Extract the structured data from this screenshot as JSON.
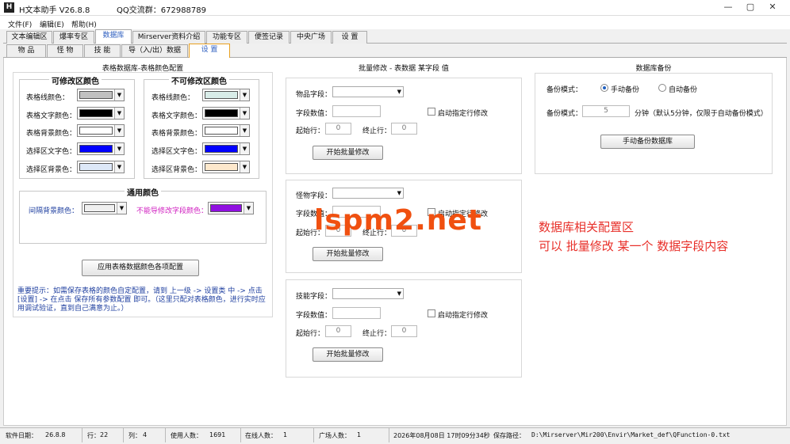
{
  "window": {
    "title": "H文本助手  V26.8.8",
    "qq": "QQ交流群：672988789",
    "controls": [
      "—",
      "▢",
      "✕"
    ]
  },
  "menu": [
    "文件(F)",
    "编辑(E)",
    "帮助(H)"
  ],
  "tabs_main": [
    "文本编辑区",
    "爆率专区",
    "数据库",
    "Mirserver资料介绍",
    "功能专区",
    "便签记录",
    "中央广场",
    "设  置"
  ],
  "tabs_sub": [
    "物  品",
    "怪  物",
    "技  能",
    "导（入/出）数据",
    "设  置"
  ],
  "color_config": {
    "title": "表格数据库-表格颜色配置",
    "editable": {
      "title": "可修改区颜色",
      "labels": [
        "表格线颜色：",
        "表格文字颜色：",
        "表格背景颜色：",
        "选择区文字色：",
        "选择区背景色："
      ],
      "colors": [
        "#c0c0c0",
        "#000000",
        "#ffffff",
        "#0000ff",
        "#dde8f8"
      ]
    },
    "readonly": {
      "title": "不可修改区颜色",
      "labels": [
        "表格线颜色：",
        "表格文字颜色：",
        "表格背景颜色：",
        "选择区文字色：",
        "选择区背景色："
      ],
      "colors": [
        "#d8ece8",
        "#000000",
        "#ffffff",
        "#0000ff",
        "#fde8cc"
      ]
    },
    "common": {
      "title": "通用颜色",
      "interval_label": "间隔背景颜色：",
      "interval_color": "#f0f0f0",
      "field_label": "不能导修改字段颜色：",
      "field_color": "#9010e0"
    },
    "apply_button": "应用表格数据颜色各项配置",
    "notice": "重要提示：如需保存表格的颜色自定配置，请到 上一级 -> 设置类 中 -> 点击 [设置] -> 在点击 保存所有参数配置 即可。（这里只配对表格颜色，进行实时应用调试验证，直到自己满意为止。）"
  },
  "batch": {
    "title": "批量修改 - 表数据 某字段 值",
    "panels": [
      {
        "field_label": "物品字段：",
        "value_label": "字段数值：",
        "checkbox": "启动指定行修改",
        "start_label": "起始行：",
        "start": "0",
        "end_label": "终止行：",
        "end": "0",
        "button": "开始批量修改"
      },
      {
        "field_label": "怪物字段：",
        "value_label": "字段数值：",
        "checkbox": "启动指定行修改",
        "start_label": "起始行：",
        "start": "0",
        "end_label": "终止行：",
        "end": "0",
        "button": "开始批量修改"
      },
      {
        "field_label": "技能字段：",
        "value_label": "字段数值：",
        "checkbox": "启动指定行修改",
        "start_label": "起始行：",
        "start": "0",
        "end_label": "终止行：",
        "end": "0",
        "button": "开始批量修改"
      }
    ]
  },
  "backup": {
    "title": "数据库备份",
    "mode_label": "备份模式：",
    "manual": "手动备份",
    "auto": "自动备份",
    "interval_label": "备份模式：",
    "interval_value": "5",
    "interval_hint": "分钟（默认5分钟，仅限于自动备份模式）",
    "button": "手动备份数据库"
  },
  "watermark": "lspm2.net",
  "annotation": [
    "数据库相关配置区",
    "可以 批量修改  某一个  数据字段内容"
  ],
  "status": {
    "version_label": "软件日期：",
    "version": "26.8.8",
    "row_label": "行：",
    "row": "22",
    "col_label": "列：",
    "col": "4",
    "users_label": "使用人数：",
    "users": "1691",
    "online_label": "在线人数：",
    "online": "1",
    "plaza_label": "广场人数：",
    "plaza": "1",
    "datetime": "2026年08月08日  17时09分34秒",
    "path_label": "保存路径：",
    "path": "D:\\Mirserver\\Mir200\\Envir\\Market_def\\QFunction-0.txt"
  }
}
